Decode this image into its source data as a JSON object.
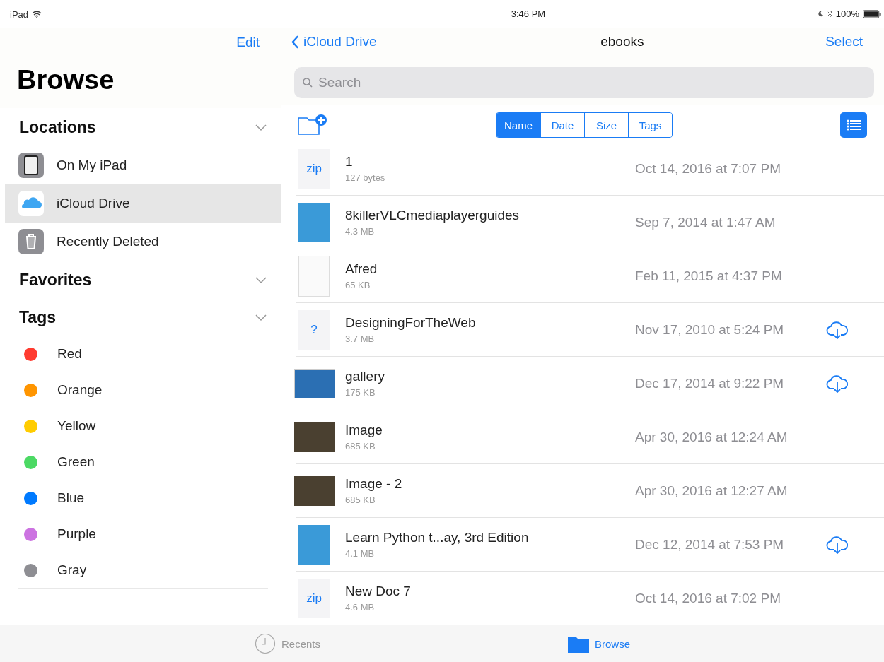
{
  "status_bar": {
    "device": "iPad",
    "time": "3:46 PM",
    "battery": "100%"
  },
  "sidebar": {
    "edit": "Edit",
    "title": "Browse",
    "sections": [
      {
        "title": "Locations",
        "expanded": true,
        "items": [
          {
            "label": "On My iPad",
            "kind": "device",
            "selected": false
          },
          {
            "label": "iCloud Drive",
            "kind": "cloud",
            "selected": true
          },
          {
            "label": "Recently Deleted",
            "kind": "trash",
            "selected": false
          }
        ]
      },
      {
        "title": "Favorites",
        "expanded": true
      },
      {
        "title": "Tags",
        "expanded": true,
        "items": [
          {
            "label": "Red",
            "kind": "tag",
            "color": "#ff3b30",
            "selected": false
          },
          {
            "label": "Orange",
            "kind": "tag",
            "color": "#ff9500",
            "selected": false
          },
          {
            "label": "Yellow",
            "kind": "tag",
            "color": "#ffcc00",
            "selected": false
          },
          {
            "label": "Green",
            "kind": "tag",
            "color": "#4cd964",
            "selected": false
          },
          {
            "label": "Blue",
            "kind": "tag",
            "color": "#007aff",
            "selected": false
          },
          {
            "label": "Purple",
            "kind": "tag",
            "color": "#cc73e1",
            "selected": false
          },
          {
            "label": "Gray",
            "kind": "tag",
            "color": "#8e8e93",
            "selected": false
          }
        ]
      }
    ]
  },
  "nav": {
    "back": "iCloud Drive",
    "title": "ebooks",
    "select": "Select"
  },
  "search": {
    "placeholder": "Search"
  },
  "sort": [
    {
      "label": "Name",
      "selected": true
    },
    {
      "label": "Date",
      "selected": false
    },
    {
      "label": "Size",
      "selected": false
    },
    {
      "label": "Tags",
      "selected": false
    }
  ],
  "files": [
    {
      "name": "1",
      "size": "127 bytes",
      "date": "Oct 14, 2016 at 7:07 PM",
      "kind": "generic",
      "badge": "zip",
      "downloadable": false
    },
    {
      "name": "8killerVLCmediaplayerguides",
      "size": "4.3 MB",
      "date": "Sep 7, 2014 at 1:47 AM",
      "kind": "cover",
      "downloadable": false
    },
    {
      "name": "Afred",
      "size": "65 KB",
      "date": "Feb 11, 2015 at 4:37 PM",
      "kind": "document",
      "downloadable": false
    },
    {
      "name": "DesigningForTheWeb",
      "size": "3.7 MB",
      "date": "Nov 17, 2010 at 5:24 PM",
      "kind": "generic",
      "badge": "?",
      "downloadable": true
    },
    {
      "name": "gallery",
      "size": "175 KB",
      "date": "Dec 17, 2014 at 9:22 PM",
      "kind": "wide",
      "downloadable": true
    },
    {
      "name": "Image",
      "size": "685 KB",
      "date": "Apr 30, 2016 at 12:24 AM",
      "kind": "photo",
      "downloadable": false
    },
    {
      "name": "Image - 2",
      "size": "685 KB",
      "date": "Apr 30, 2016 at 12:27 AM",
      "kind": "photo",
      "downloadable": false
    },
    {
      "name": "Learn Python t...ay, 3rd Edition",
      "size": "4.1 MB",
      "date": "Dec 12, 2014 at 7:53 PM",
      "kind": "cover",
      "downloadable": true
    },
    {
      "name": "New Doc 7",
      "size": "4.6 MB",
      "date": "Oct 14, 2016 at 7:02 PM",
      "kind": "generic",
      "badge": "zip",
      "downloadable": false
    }
  ],
  "tab_bar": [
    {
      "label": "Recents",
      "kind": "clock",
      "selected": false
    },
    {
      "label": "Browse",
      "kind": "folder",
      "selected": true
    }
  ]
}
